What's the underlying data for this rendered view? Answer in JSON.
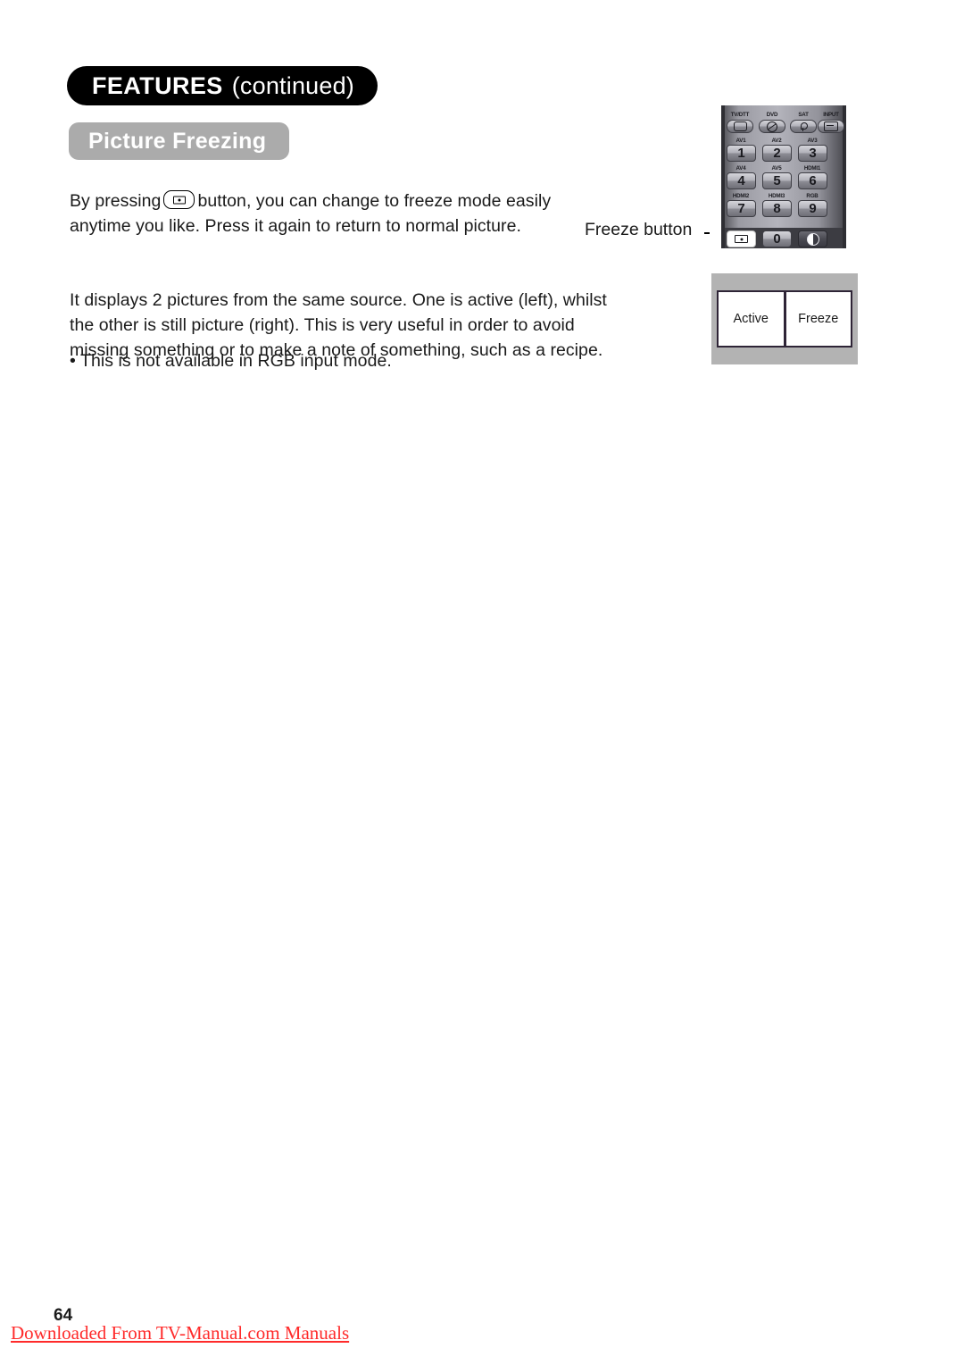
{
  "header": {
    "title_strong": "FEATURES",
    "title_light": "(continued)",
    "subtitle": "Picture Freezing"
  },
  "body": {
    "para1_before": "By pressing",
    "para1_button_icon": "freeze-button-icon",
    "para1_after": "button, you can change to freeze mode easily anytime you like. Press it again to return to normal picture.",
    "para2": "It displays 2 pictures from the same source. One is active (left), whilst the other is still picture (right). This is very useful in order to avoid missing something or to make a note of something, such as a recipe.",
    "bullet": "• This is not available in RGB input mode."
  },
  "callout": {
    "freeze_button_label": "Freeze button"
  },
  "remote": {
    "top_row": [
      {
        "label": "TV/DTT",
        "icon": "tv-icon"
      },
      {
        "label": "DVD",
        "icon": "disc-icon"
      },
      {
        "label": "SAT",
        "icon": "satellite-icon"
      },
      {
        "label": "INPUT",
        "icon": "input-source-icon"
      }
    ],
    "number_rows": [
      [
        {
          "label": "AV1",
          "digit": "1"
        },
        {
          "label": "AV2",
          "digit": "2"
        },
        {
          "label": "AV3",
          "digit": "3"
        }
      ],
      [
        {
          "label": "AV4",
          "digit": "4"
        },
        {
          "label": "AV5",
          "digit": "5"
        },
        {
          "label": "HDMI1",
          "digit": "6"
        }
      ],
      [
        {
          "label": "HDMI2",
          "digit": "7"
        },
        {
          "label": "HDMI3",
          "digit": "8"
        },
        {
          "label": "RGB",
          "digit": "9"
        }
      ]
    ],
    "bottom_row": [
      {
        "digit": "",
        "icon": "freeze-icon",
        "highlighted": true
      },
      {
        "digit": "0",
        "icon": "",
        "highlighted": false
      },
      {
        "digit": "",
        "icon": "contrast-icon",
        "highlighted": false
      }
    ]
  },
  "screen_diagram": {
    "left_pane": "Active",
    "right_pane": "Freeze"
  },
  "footer": {
    "page_number": "64",
    "link_text": "Downloaded From TV-Manual.com Manuals"
  },
  "colors": {
    "title_pill_bg": "#000000",
    "subtitle_pill_bg": "#ababab",
    "footer_link": "#ff2b2b",
    "diagram_bg": "#b3b3b3"
  }
}
